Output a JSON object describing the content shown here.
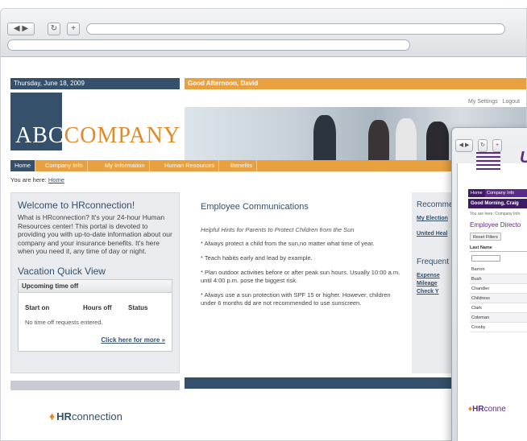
{
  "browser": {
    "back": "◀",
    "forward": "▶",
    "reload": "↻",
    "new_tab": "+"
  },
  "page": {
    "date": "Thursday, June 18, 2009",
    "greeting": "Good Afternoon, David",
    "links": [
      "My Settings",
      "Logout"
    ],
    "logo": {
      "abc": "ABC",
      "company": "COMPANY"
    },
    "nav": [
      "Home",
      "Company Info",
      "My Information",
      "Human Resources",
      "Benefits"
    ],
    "breadcrumb_prefix": "You are here:",
    "breadcrumb_link": "Home",
    "welcome": {
      "title": "Welcome to HRconnection!",
      "body": "What is HRconnection? It's your 24-hour Human Resources center! This portal is devoted to providing you with up-to-date information about our company and your insurance benefits. It's here when you need it, any time of day or night."
    },
    "vacation": {
      "title": "Vacation Quick View",
      "box_title": "Upcoming time off",
      "columns": [
        "Start on",
        "Hours off",
        "Status"
      ],
      "empty": "No time off requests entered.",
      "more": "Click here for more »"
    },
    "communications": {
      "title": "Employee Communications",
      "hint_title": "Helpful Hints for Parents to Protect Children from the Sun",
      "hints": [
        "* Always protect a child from the sun,no matter what time of year.",
        "* Teach habits early and lead by example.",
        "* Plan outdoor activities before or after peak sun hours.  Usually 10:00 a.m. until 4:00 p.m. pose the biggest risk.",
        "* Always use a sun protection with SPF 15 or higher. However, children under 6    months dd are not recommended to use sunscreen."
      ]
    },
    "right": {
      "title1": "Recomme",
      "links1": [
        "My Election",
        "United Heal"
      ],
      "title2": "Frequent",
      "links2": [
        "Expense",
        "Mileage",
        "Check Y"
      ]
    },
    "footer_logo": {
      "bold": "HR",
      "thin": "connection"
    }
  },
  "second_window": {
    "logo_letter": "U",
    "nav": [
      "Home",
      "Company Info"
    ],
    "greeting": "Good Morning, Craig",
    "breadcrumb": "You are here: Company Info",
    "directory_title": "Employee Directo",
    "reset": "Reset Filters",
    "column": "Last Name",
    "rows": [
      "Barron",
      "Bush",
      "Chandler",
      "Childress",
      "Clark",
      "Coleman",
      "Crosby"
    ],
    "footer_logo": {
      "bold": "HR",
      "thin": "conne"
    }
  },
  "colors": {
    "navy": "#34506b",
    "orange": "#e8a040",
    "purple": "#5b2c85"
  }
}
